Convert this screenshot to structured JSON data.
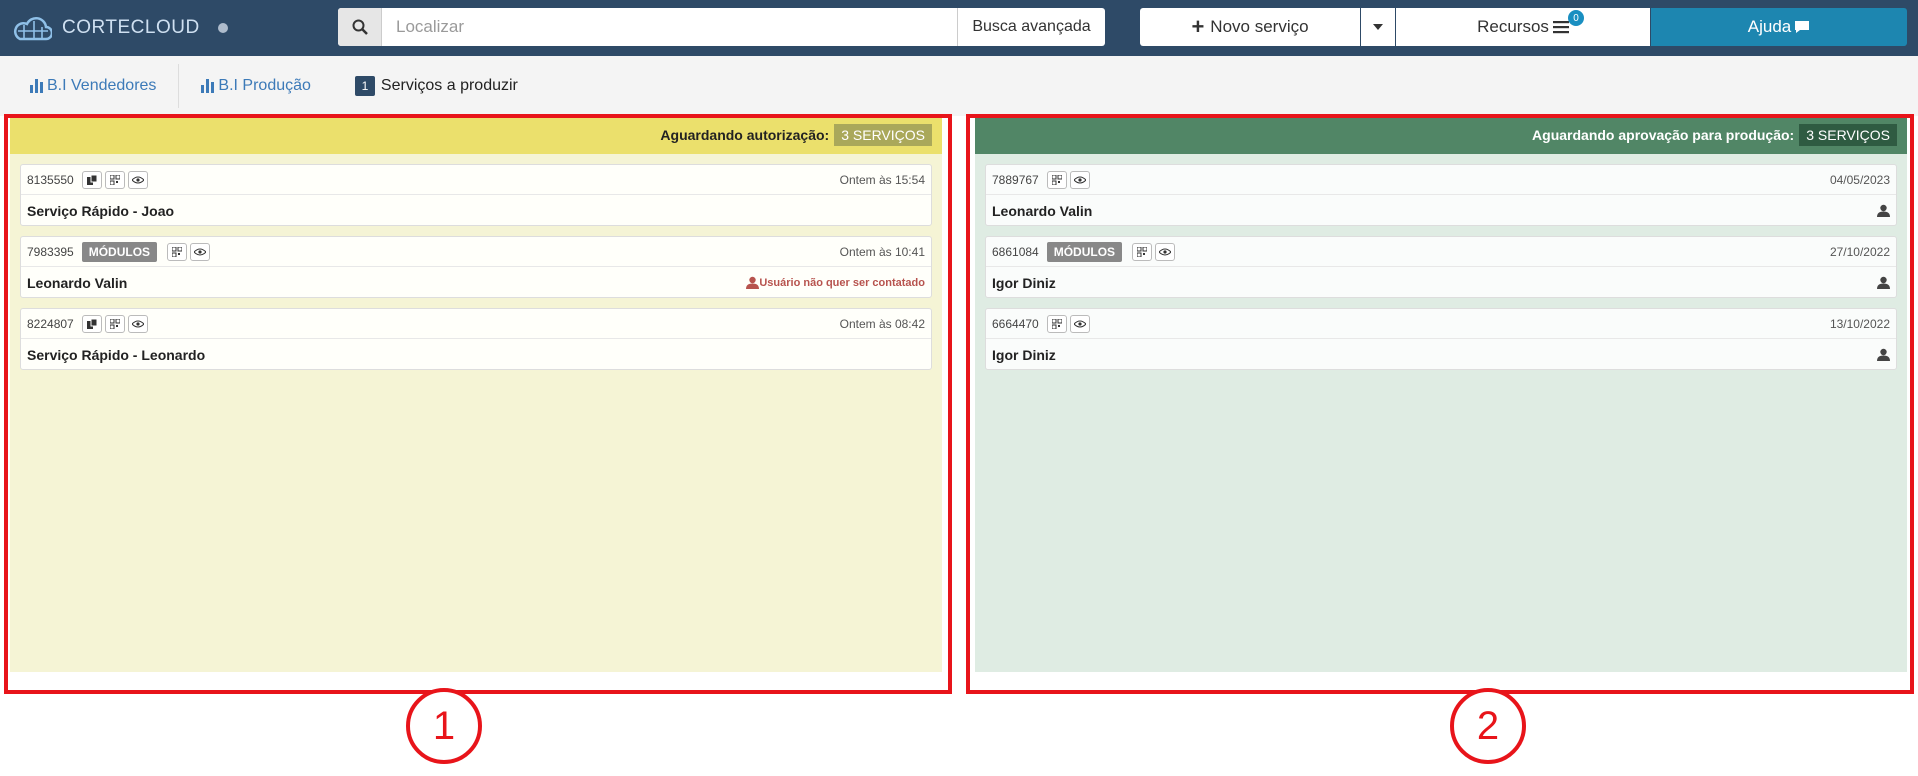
{
  "header": {
    "logo_text": "CORTECLOUD",
    "search_placeholder": "Localizar",
    "advanced_search": "Busca avançada",
    "new_service": "Novo serviço",
    "resources": "Recursos",
    "resources_badge": "0",
    "help": "Ajuda"
  },
  "subnav": {
    "items": [
      {
        "label": "B.I Vendedores"
      },
      {
        "label": "B.I Produção"
      },
      {
        "label": "Serviços a produzir",
        "count": "1"
      }
    ]
  },
  "panels": [
    {
      "title": "Aguardando autorização:",
      "count": "3 SERVIÇOS",
      "cards": [
        {
          "id": "8135550",
          "time": "Ontem às 15:54",
          "name": "Serviço Rápido - Joao"
        },
        {
          "id": "7983395",
          "tag": "MÓDULOS",
          "time": "Ontem às 10:41",
          "name": "Leonardo Valin",
          "warning": "Usuário não quer ser contatado"
        },
        {
          "id": "8224807",
          "time": "Ontem às 08:42",
          "name": "Serviço Rápido - Leonardo"
        }
      ]
    },
    {
      "title": "Aguardando aprovação para produção:",
      "count": "3 SERVIÇOS",
      "cards": [
        {
          "id": "7889767",
          "time": "04/05/2023",
          "name": "Leonardo Valin"
        },
        {
          "id": "6861084",
          "tag": "MÓDULOS",
          "time": "27/10/2022",
          "name": "Igor Diniz"
        },
        {
          "id": "6664470",
          "time": "13/10/2022",
          "name": "Igor Diniz"
        }
      ]
    }
  ],
  "annotations": {
    "label_1": "1",
    "label_2": "2"
  },
  "colors": {
    "panel1_header": "#ebe06c",
    "panel2_header": "#518666",
    "annotation": "#e8141a",
    "topbar": "#2e4a67"
  }
}
